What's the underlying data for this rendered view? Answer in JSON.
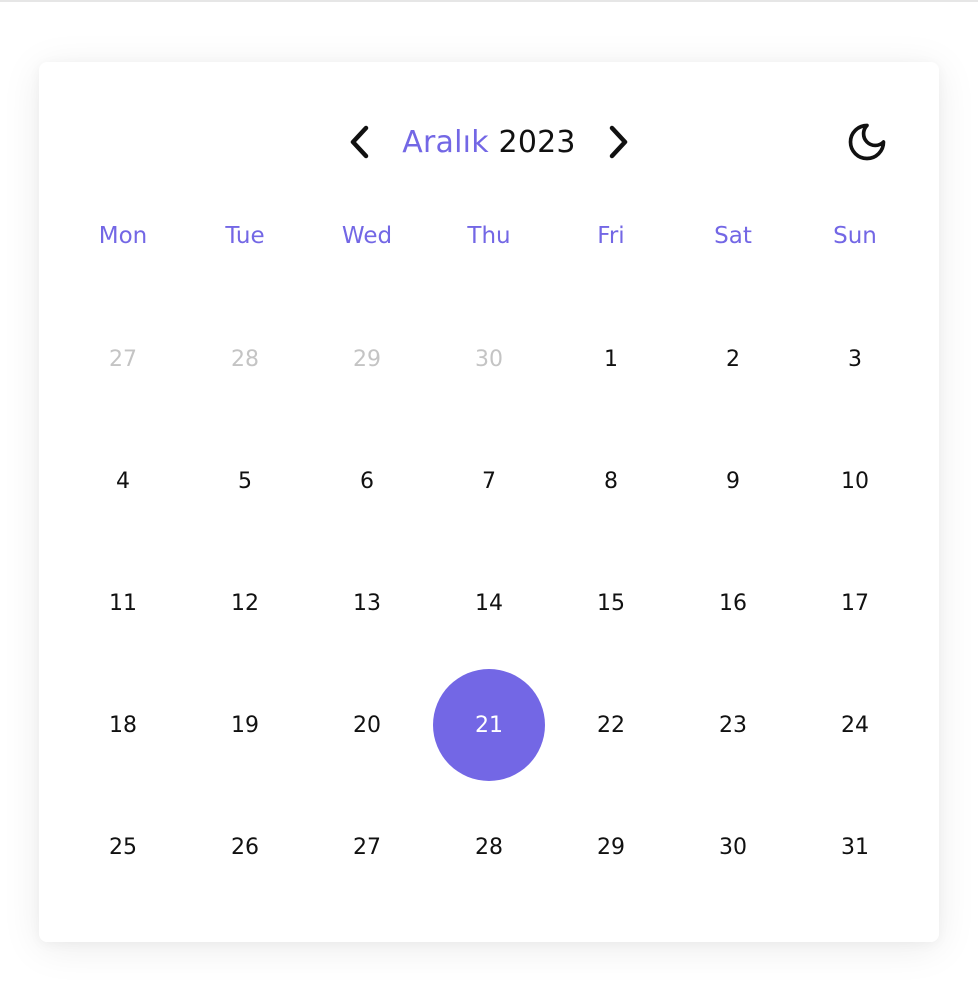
{
  "header": {
    "month": "Aralık",
    "year": "2023",
    "prev_icon": "chevron-left-icon",
    "next_icon": "chevron-right-icon",
    "theme_icon": "moon-icon"
  },
  "colors": {
    "accent": "#7367e5",
    "text": "#111111",
    "muted": "#c4c4c4"
  },
  "weekdays": [
    "Mon",
    "Tue",
    "Wed",
    "Thu",
    "Fri",
    "Sat",
    "Sun"
  ],
  "days": [
    {
      "label": "27",
      "state": "other-month"
    },
    {
      "label": "28",
      "state": "other-month"
    },
    {
      "label": "29",
      "state": "other-month"
    },
    {
      "label": "30",
      "state": "other-month"
    },
    {
      "label": "1",
      "state": "current"
    },
    {
      "label": "2",
      "state": "current"
    },
    {
      "label": "3",
      "state": "current"
    },
    {
      "label": "4",
      "state": "current"
    },
    {
      "label": "5",
      "state": "current"
    },
    {
      "label": "6",
      "state": "current"
    },
    {
      "label": "7",
      "state": "current"
    },
    {
      "label": "8",
      "state": "current"
    },
    {
      "label": "9",
      "state": "current"
    },
    {
      "label": "10",
      "state": "current"
    },
    {
      "label": "11",
      "state": "current"
    },
    {
      "label": "12",
      "state": "current"
    },
    {
      "label": "13",
      "state": "current"
    },
    {
      "label": "14",
      "state": "current"
    },
    {
      "label": "15",
      "state": "current"
    },
    {
      "label": "16",
      "state": "current"
    },
    {
      "label": "17",
      "state": "current"
    },
    {
      "label": "18",
      "state": "current"
    },
    {
      "label": "19",
      "state": "current"
    },
    {
      "label": "20",
      "state": "current"
    },
    {
      "label": "21",
      "state": "selected"
    },
    {
      "label": "22",
      "state": "current"
    },
    {
      "label": "23",
      "state": "current"
    },
    {
      "label": "24",
      "state": "current"
    },
    {
      "label": "25",
      "state": "current"
    },
    {
      "label": "26",
      "state": "current"
    },
    {
      "label": "27",
      "state": "current"
    },
    {
      "label": "28",
      "state": "current"
    },
    {
      "label": "29",
      "state": "current"
    },
    {
      "label": "30",
      "state": "current"
    },
    {
      "label": "31",
      "state": "current"
    }
  ]
}
